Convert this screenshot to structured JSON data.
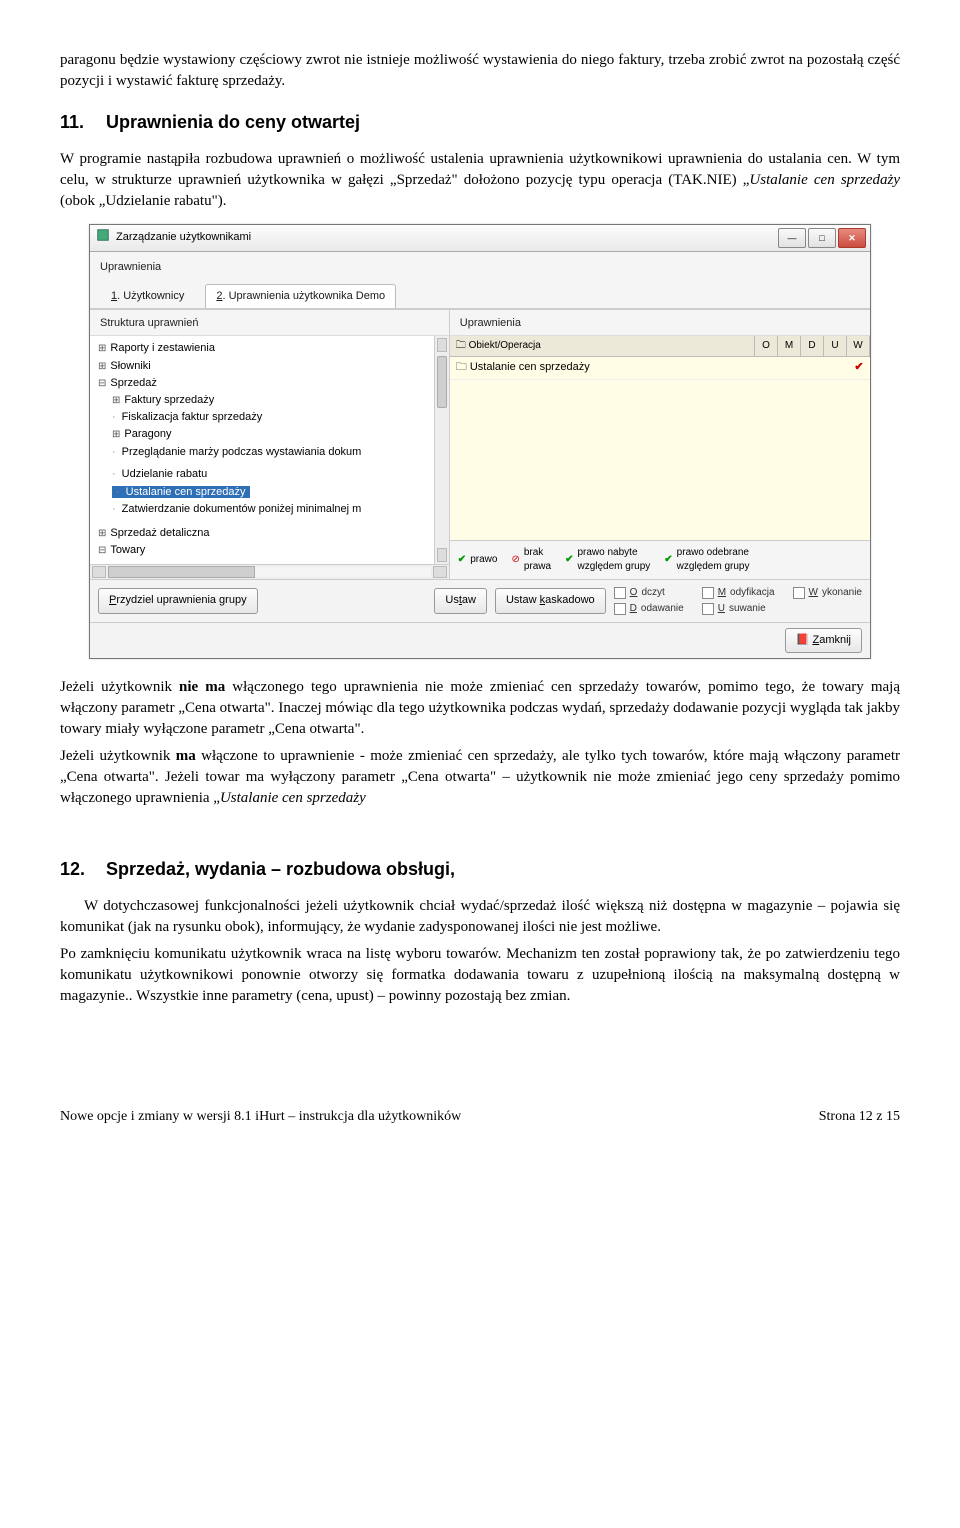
{
  "intro_para": "paragonu będzie wystawiony częściowy zwrot nie istnieje możliwość wystawienia do niego faktury, trzeba zrobić zwrot na pozostałą część pozycji i wystawić fakturę sprzedaży.",
  "section11": {
    "num": "11.",
    "title": "Uprawnienia do ceny otwartej",
    "p1_a": "W programie nastąpiła rozbudowa uprawnień o możliwość ustalenia uprawnienia użytkownikowi uprawnienia do ustalania cen. W tym celu, w strukturze uprawnień użytkownika w gałęzi „Sprzedaż\" dołożono pozycję typu operacja (TAK.NIE) „",
    "p1_b": "Ustalanie cen sprzedaży",
    "p1_c": " (obok „Udzielanie rabatu\")."
  },
  "window": {
    "title": "Zarządzanie użytkownikami",
    "subhead": "Uprawnienia",
    "tabs": [
      "1. Użytkownicy",
      "2. Uprawnienia użytkownika Demo"
    ],
    "tabs_und": [
      "1",
      "2"
    ],
    "left_title": "Struktura uprawnień",
    "tree": {
      "items": [
        {
          "label": "Raporty i zestawienia",
          "type": "hasChildren"
        },
        {
          "label": "Słowniki",
          "type": "hasChildren"
        },
        {
          "label": "Sprzedaż",
          "type": "expanded",
          "children": [
            {
              "label": "Faktury sprzedaży",
              "type": "hasChildren"
            },
            {
              "label": "Fiskalizacja faktur sprzedaży",
              "type": "leaf"
            },
            {
              "label": "Paragony",
              "type": "hasChildren"
            },
            {
              "label": "Przeglądanie marży podczas wystawiania dokum",
              "type": "leaf",
              "cut": true
            },
            {
              "label": "Udzielanie rabatu",
              "type": "leaf"
            },
            {
              "label": "Ustalanie cen sprzedaży",
              "type": "leaf",
              "selected": true
            },
            {
              "label": "Zatwierdzanie dokumentów poniżej minimalnej m",
              "type": "leaf",
              "cut": true
            }
          ]
        },
        {
          "label": "Sprzedaż detaliczna",
          "type": "hasChildren"
        },
        {
          "label": "Towary",
          "type": "expanded"
        }
      ]
    },
    "right_title": "Uprawnienia",
    "columns": {
      "c1": "Obiekt/Operacja",
      "small": [
        "O",
        "M",
        "D",
        "U",
        "W"
      ]
    },
    "perm_row": "Ustalanie cen sprzedaży",
    "legend": [
      {
        "icon": "tick",
        "label": "prawo"
      },
      {
        "icon": "no",
        "label": "brak\nprawa"
      },
      {
        "icon": "tick",
        "label": "prawo nabyte\nwzględem grupy"
      },
      {
        "icon": "tick",
        "label": "prawo odebrane\nwzględem grupy"
      }
    ],
    "btn_group": "Przydziel uprawnienia grupy",
    "btn_set": "Ustaw",
    "btn_cascade": "Ustaw kaskadowo",
    "rights_labels": {
      "o": "Odczyt",
      "m": "Modyfikacja",
      "w": "Wykonanie",
      "d": "Dodawanie",
      "u": "Usuwanie"
    },
    "btn_close": "Zamknij"
  },
  "after_screenshot": {
    "p1_a": "Jeżeli użytkownik ",
    "p1_b": "nie ma",
    "p1_c": " włączonego tego uprawnienia nie może zmieniać cen sprzedaży towarów, pomimo tego, że towary mają włączony parametr „Cena otwarta\". Inaczej mówiąc dla tego użytkownika podczas wydań, sprzedaży dodawanie pozycji wygląda tak jakby towary miały wyłączone parametr „Cena otwarta\".",
    "p2_a": "Jeżeli użytkownik ",
    "p2_b": "ma",
    "p2_c": " włączone to uprawnienie - może zmieniać cen sprzedaży, ale tylko tych towarów, które mają włączony parametr „Cena otwarta\". Jeżeli towar ma wyłączony parametr „Cena otwarta\" – użytkownik nie może zmieniać jego ceny sprzedaży pomimo włączonego uprawnienia „",
    "p2_d": "Ustalanie cen sprzedaży"
  },
  "section12": {
    "num": "12.",
    "title": "Sprzedaż, wydania – rozbudowa obsługi,",
    "p1": "W dotychczasowej funkcjonalności jeżeli użytkownik chciał wydać/sprzedaż ilość większą niż dostępna w magazynie – pojawia się komunikat (jak na rysunku obok), informujący, że wydanie zadysponowanej ilości nie jest możliwe.",
    "p2": "Po zamknięciu komunikatu użytkownik wraca na listę wyboru towarów. Mechanizm ten został poprawiony tak, że po zatwierdzeniu tego komunikatu użytkownikowi ponownie otworzy się formatka dodawania towaru z uzupełnioną ilością na maksymalną dostępną w magazynie.. Wszystkie inne parametry (cena, upust) – powinny pozostają bez zmian."
  },
  "footer": {
    "left": "Nowe opcje i zmiany w wersji 8.1 iHurt – instrukcja dla użytkowników",
    "right": "Strona 12 z 15"
  }
}
